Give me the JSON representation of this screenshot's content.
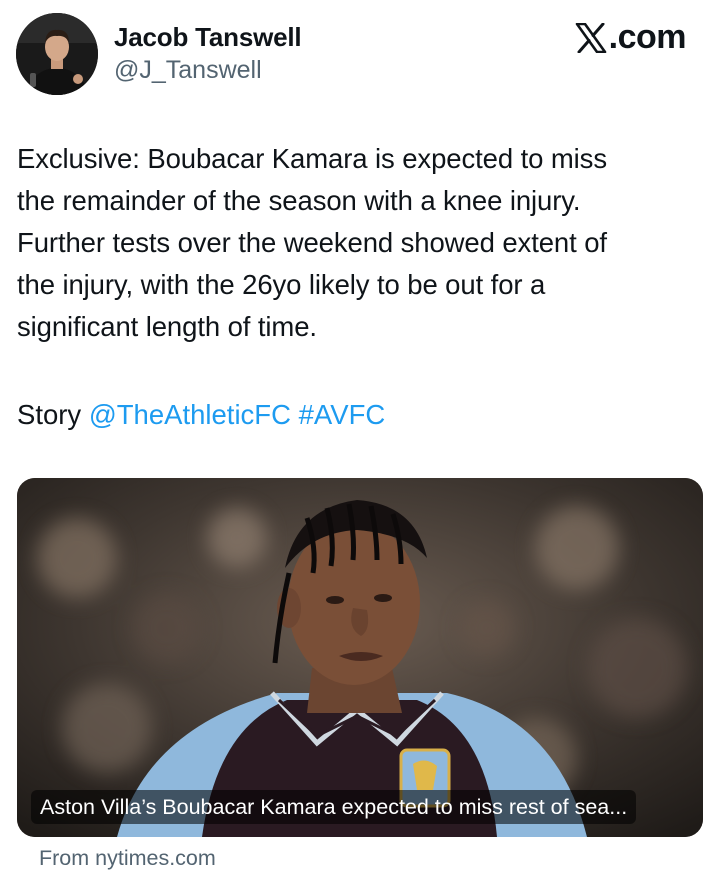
{
  "author": {
    "display_name": "Jacob Tanswell",
    "handle": "@J_Tanswell",
    "avatar_icon": "profile-avatar"
  },
  "brand": {
    "domain": ".com",
    "logo_icon": "x-logo-icon"
  },
  "tweet": {
    "lines": [
      "Exclusive: Boubacar Kamara is expected to miss",
      "the remainder of the season with a knee injury.",
      "Further tests over the weekend showed extent of",
      "the injury, with the 26yo likely to be out for a",
      "significant length of time."
    ],
    "story_prefix": "Story",
    "mention": "@TheAthleticFC",
    "hashtag": "#AVFC"
  },
  "card": {
    "image_icon": "player-photo",
    "caption": "Aston Villa’s Boubacar Kamara expected to miss rest of sea...",
    "source": "From nytimes.com"
  },
  "colors": {
    "text": "#0f1419",
    "secondary": "#536471",
    "link": "#1d9bf0",
    "kit_claret": "#2a1a22",
    "kit_blue": "#8fb8dc"
  }
}
